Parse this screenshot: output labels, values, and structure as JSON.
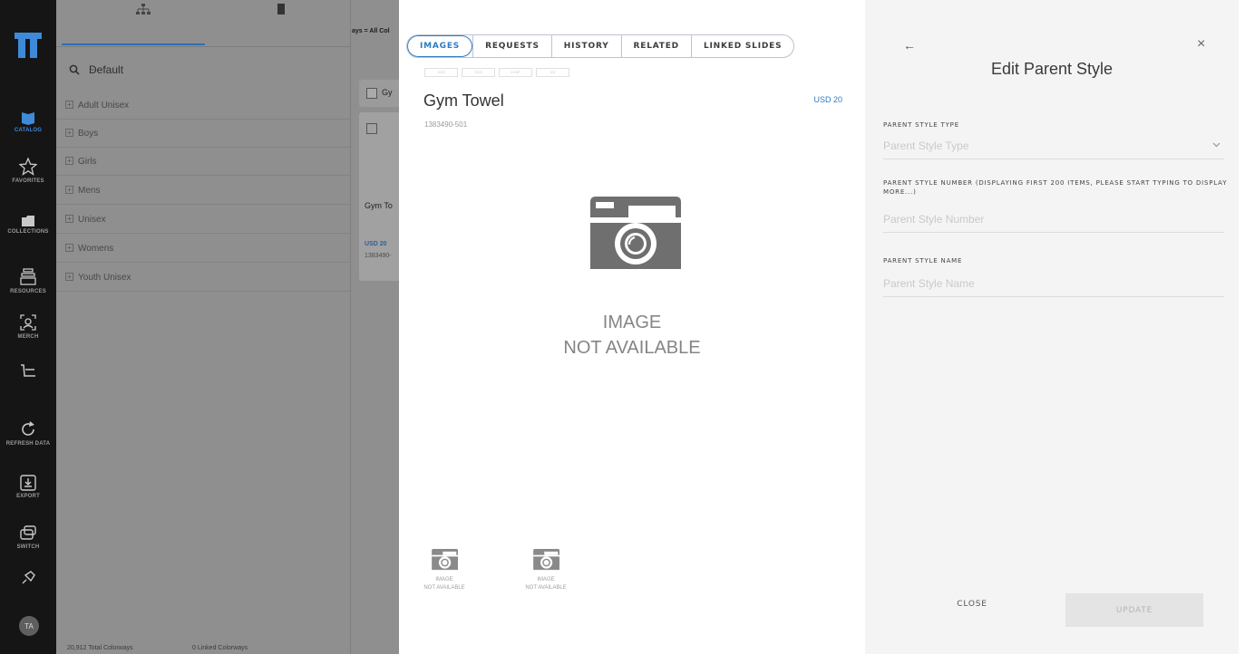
{
  "rail": {
    "items": [
      {
        "label": "CATALOG",
        "icon": "catalog-book-icon",
        "active": true
      },
      {
        "label": "FAVORITES",
        "icon": "star-icon"
      },
      {
        "label": "COLLECTIONS",
        "icon": "folder-icon"
      },
      {
        "label": "RESOURCES",
        "icon": "resources-icon"
      },
      {
        "label": "MERCH",
        "icon": "merch-icon"
      },
      {
        "label": "",
        "icon": "basket-icon"
      },
      {
        "label": "REFRESH DATA",
        "icon": "refresh-icon"
      },
      {
        "label": "EXPORT",
        "icon": "export-icon"
      },
      {
        "label": "SWITCH",
        "icon": "switch-icon"
      },
      {
        "label": "",
        "icon": "pin-icon"
      }
    ],
    "avatar": "TA"
  },
  "background": {
    "search_value": "Default",
    "categories": [
      "Adult Unisex",
      "Boys",
      "Girls",
      "Mens",
      "Unisex",
      "Womens",
      "Youth Unisex"
    ],
    "breadcrumb": "ays = All Col",
    "grid_header_text": "Gy",
    "card": {
      "name": "Gym To",
      "price": "USD 20",
      "number": "1383490-"
    },
    "footer": {
      "total": "20,912 Total Colorways",
      "linked": "0 Linked Colorways"
    }
  },
  "product": {
    "tabs": [
      "IMAGES",
      "REQUESTS",
      "HISTORY",
      "RELATED",
      "LINKED SLIDES"
    ],
    "active_tab": "IMAGES",
    "sizes": [
      "XXS",
      "XXS",
      "XXXP",
      "XS"
    ],
    "title": "Gym Towel",
    "price": "USD 20",
    "style_number": "1383490-501",
    "image_placeholder": {
      "line1": "IMAGE",
      "line2": "NOT AVAILABLE"
    },
    "thumbnails": [
      {
        "line1": "IMAGE",
        "line2": "NOT AVAILABLE"
      },
      {
        "line1": "IMAGE",
        "line2": "NOT AVAILABLE"
      }
    ]
  },
  "edit_panel": {
    "title": "Edit Parent Style",
    "back_icon": "arrow-left-icon",
    "close_icon": "close-x-icon",
    "fields": [
      {
        "label": "PARENT STYLE TYPE",
        "placeholder": "Parent Style Type",
        "has_dropdown": true
      },
      {
        "label": "PARENT STYLE NUMBER (DISPLAYING FIRST 200 ITEMS, PLEASE START TYPING TO DISPLAY MORE...)",
        "placeholder": "Parent Style Number",
        "has_dropdown": false
      },
      {
        "label": "PARENT STYLE NAME",
        "placeholder": "Parent Style Name",
        "has_dropdown": false
      }
    ],
    "close_label": "CLOSE",
    "update_label": "UPDATE"
  },
  "colors": {
    "accent": "#2c7cc3",
    "rail_bg": "#151515",
    "overlay_bg": "#8f8f8f"
  }
}
